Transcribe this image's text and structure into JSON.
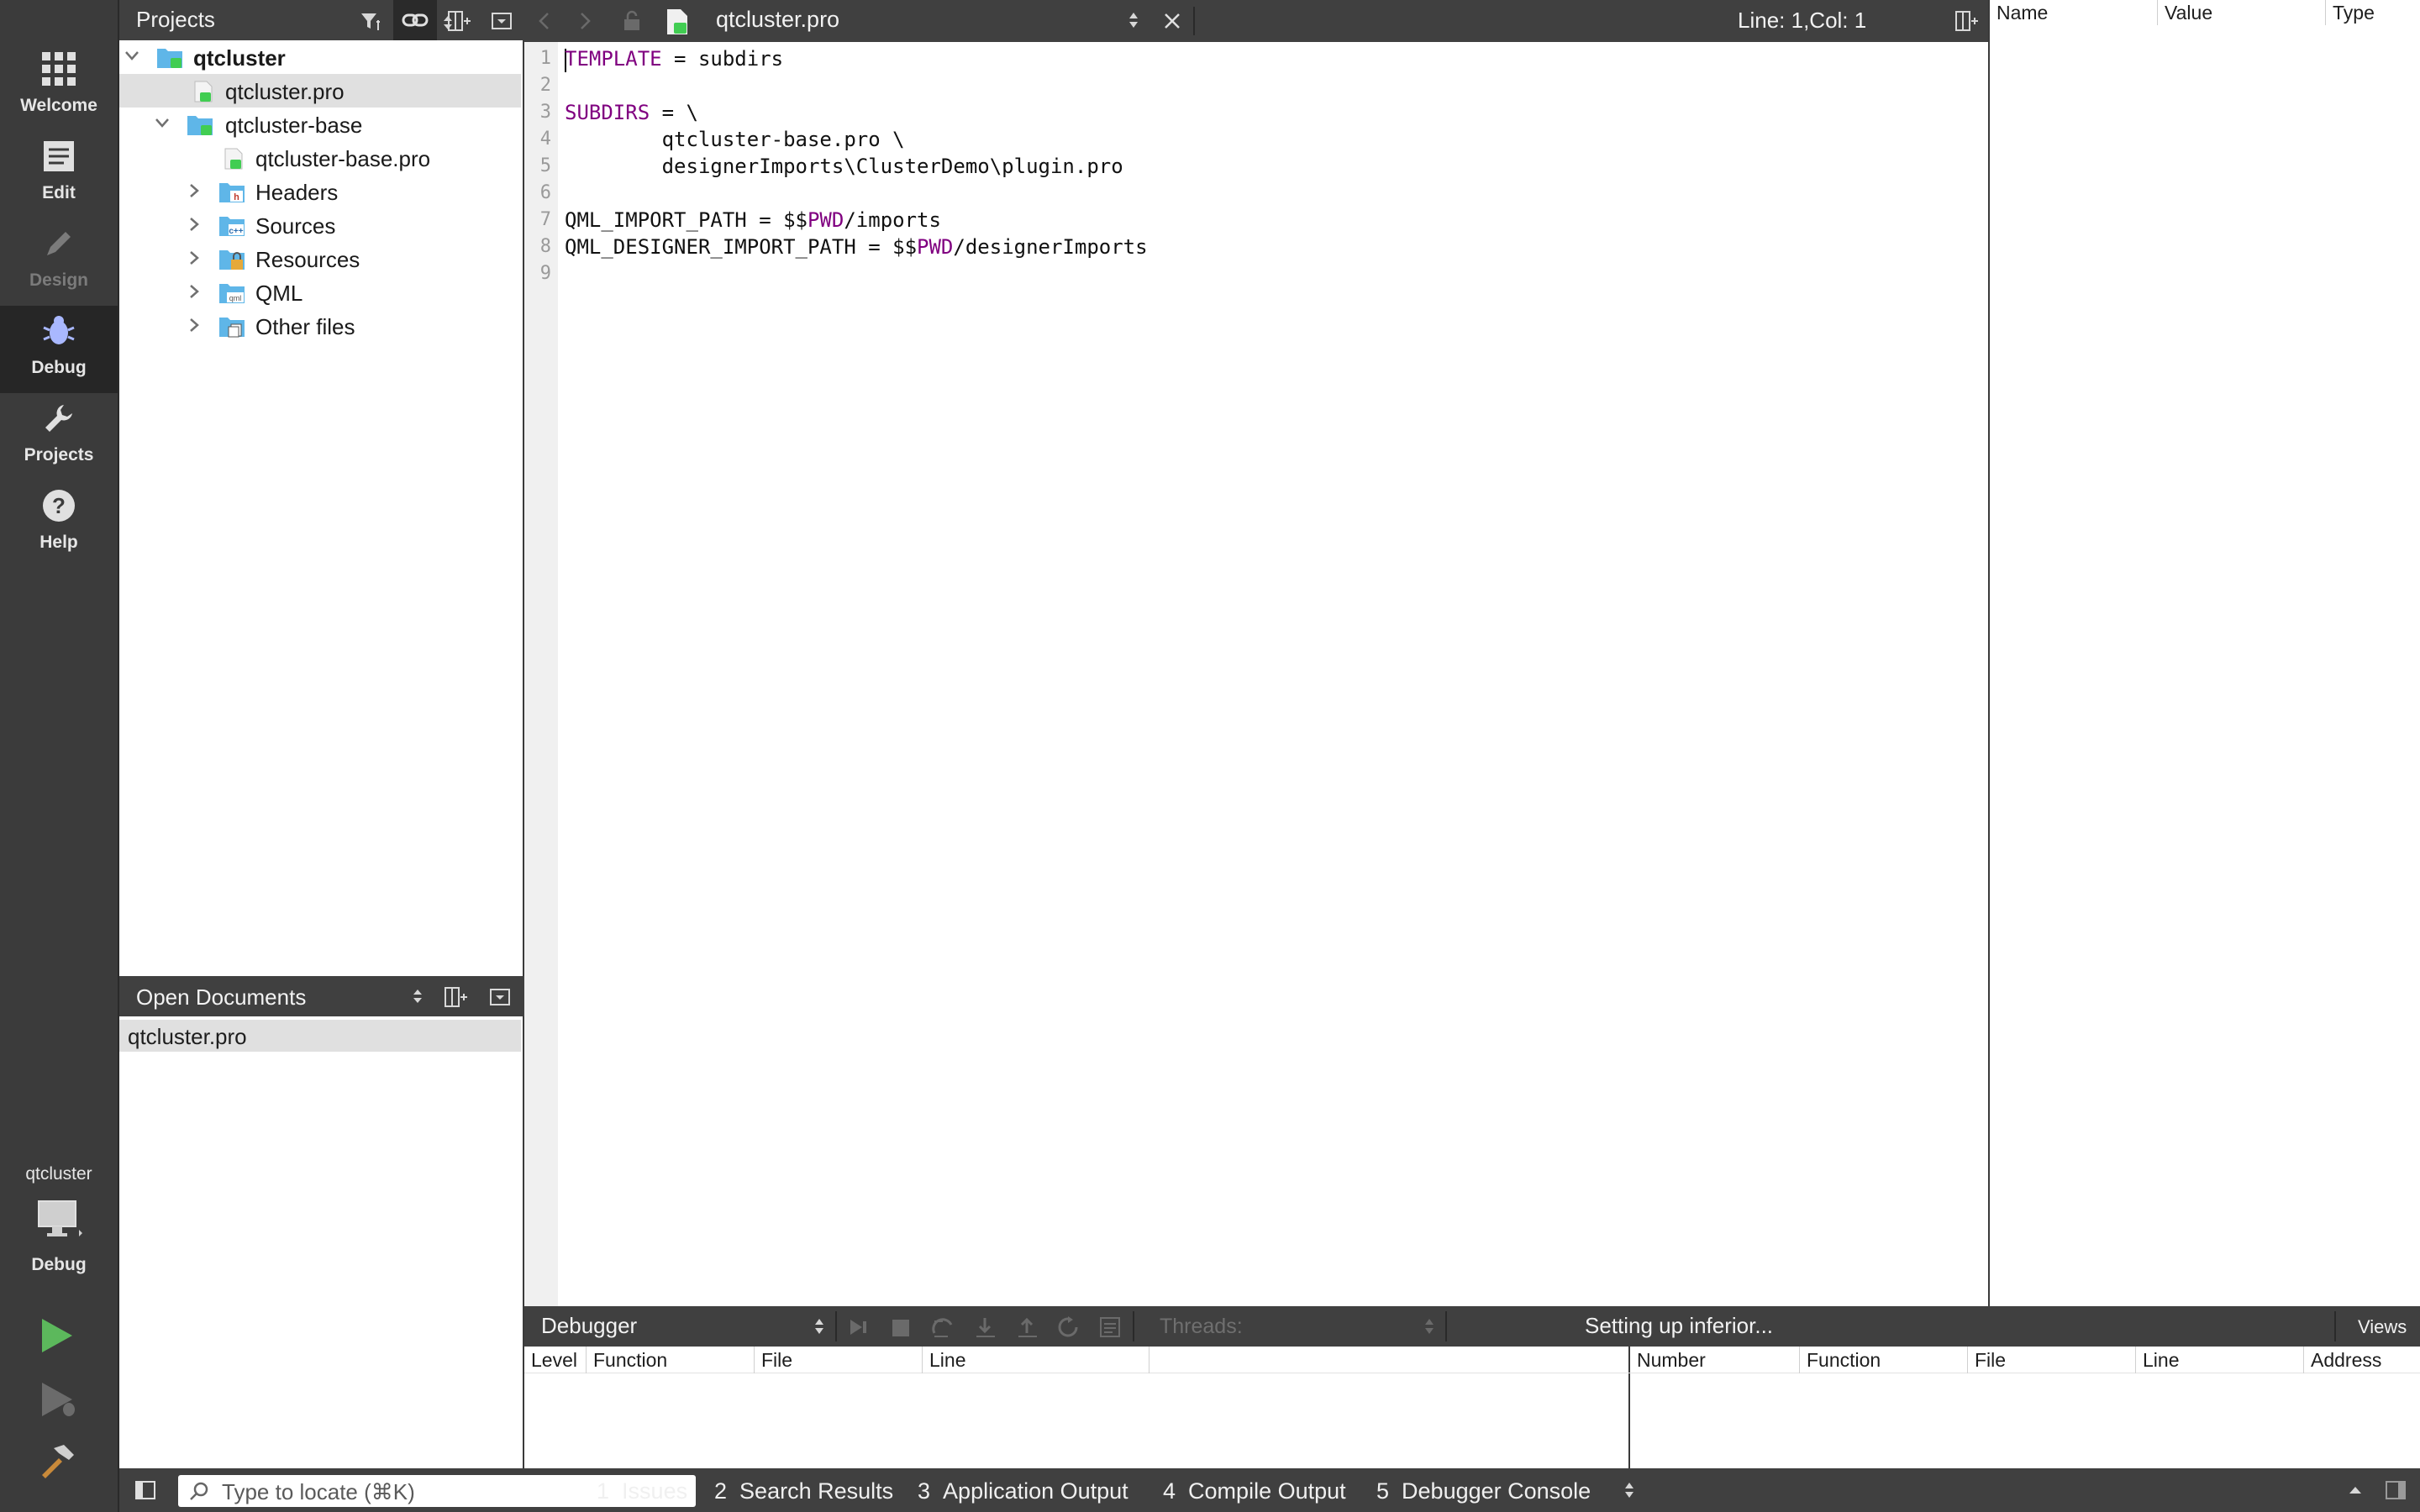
{
  "modebar": {
    "modes": [
      {
        "label": "Welcome",
        "icon": "grid-icon"
      },
      {
        "label": "Edit",
        "icon": "document-icon"
      },
      {
        "label": "Design",
        "icon": "pencil-icon"
      },
      {
        "label": "Debug",
        "icon": "bug-icon"
      },
      {
        "label": "Projects",
        "icon": "wrench-icon"
      },
      {
        "label": "Help",
        "icon": "help-icon"
      }
    ],
    "kit_name": "qtcluster",
    "kit_mode": "Debug"
  },
  "projects": {
    "title": "Projects",
    "tree": [
      {
        "label": "qtcluster"
      },
      {
        "label": "qtcluster.pro"
      },
      {
        "label": "qtcluster-base"
      },
      {
        "label": "qtcluster-base.pro"
      },
      {
        "label": "Headers"
      },
      {
        "label": "Sources"
      },
      {
        "label": "Resources"
      },
      {
        "label": "QML"
      },
      {
        "label": "Other files"
      }
    ]
  },
  "open_documents": {
    "title": "Open Documents",
    "items": [
      "qtcluster.pro"
    ]
  },
  "editor": {
    "file_name": "qtcluster.pro",
    "position": "Line: 1,Col: 1",
    "line_numbers": [
      "1",
      "2",
      "3",
      "4",
      "5",
      "6",
      "7",
      "8",
      "9"
    ],
    "code": {
      "l1_kw": "TEMPLATE",
      "l1_rest": " = subdirs",
      "l3_kw": "SUBDIRS",
      "l3_rest": " = \\",
      "l4": "        qtcluster-base.pro \\",
      "l5": "        designerImports\\ClusterDemo\\plugin.pro",
      "l7_a": "QML_IMPORT_PATH = $$",
      "l7_kw": "PWD",
      "l7_b": "/imports",
      "l8_a": "QML_DESIGNER_IMPORT_PATH = $$",
      "l8_kw": "PWD",
      "l8_b": "/designerImports"
    }
  },
  "locals": {
    "columns": [
      "Name",
      "Value",
      "Type"
    ]
  },
  "debugger": {
    "selector": "Debugger",
    "threads_label": "Threads:",
    "status": "Setting up inferior...",
    "views_label": "Views",
    "stack_columns": [
      "Level",
      "Function",
      "File",
      "Line"
    ],
    "breakpoint_columns": [
      "Number",
      "Function",
      "File",
      "Line",
      "Address"
    ]
  },
  "statusbar": {
    "locator_placeholder": "Type to locate (⌘K)",
    "tabs": [
      {
        "num": "1",
        "label": "Issues"
      },
      {
        "num": "2",
        "label": "Search Results"
      },
      {
        "num": "3",
        "label": "Application Output"
      },
      {
        "num": "4",
        "label": "Compile Output"
      },
      {
        "num": "5",
        "label": "Debugger Console"
      }
    ]
  },
  "colors": {
    "keyword": "#800080",
    "run_green": "#5cb85c",
    "panel_dark": "#404040"
  }
}
